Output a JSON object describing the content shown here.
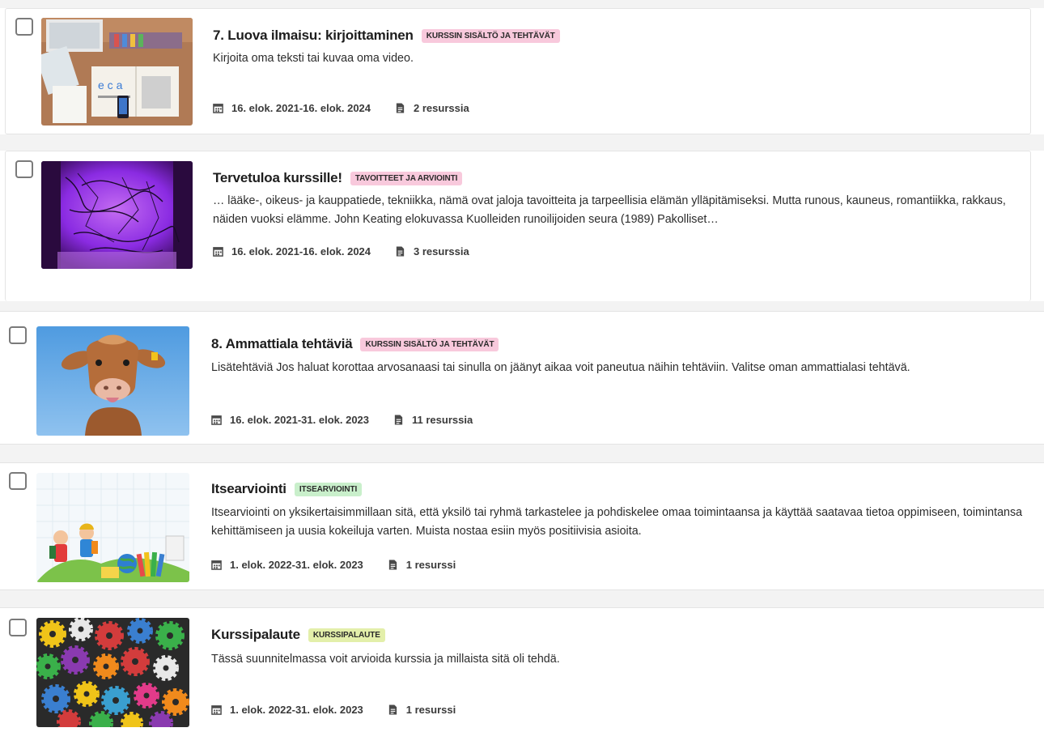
{
  "colors": {
    "badge_pink": "#f8c9dc",
    "badge_green": "#c9efcb",
    "badge_lime": "#e3efaa",
    "separator_gray": "#f3f3f3",
    "icon_gray": "#4a4a4a"
  },
  "cards": [
    {
      "title": "7. Luova ilmaisu: kirjoittaminen",
      "badge": "KURSSIN SISÄLTÖ JA TEHTÄVÄT",
      "description": "Kirjoita oma teksti tai kuvaa oma video.",
      "dates": "16. elok. 2021-16. elok. 2024",
      "resources": "2 resurssia"
    },
    {
      "title": "Tervetuloa kurssille!",
      "badge": "TAVOITTEET JA ARVIOINTI",
      "description": "… lääke-, oikeus- ja kauppatiede, tekniikka, nämä ovat jaloja tavoitteita ja tarpeellisia elämän ylläpitämiseksi. Mutta runous, kauneus, romantiikka, rakkaus, näiden vuoksi elämme.   John Keating elokuvassa Kuolleiden runoilijoiden seura (1989)   Pakolliset…",
      "dates": "16. elok. 2021-16. elok. 2024",
      "resources": "3 resurssia"
    },
    {
      "title": "8. Ammattiala tehtäviä",
      "badge": "KURSSIN SISÄLTÖ JA TEHTÄVÄT",
      "description": "Lisätehtäviä Jos haluat korottaa arvosanaasi tai sinulla on jäänyt aikaa voit paneutua näihin tehtäviin. Valitse oman ammattialasi tehtävä.",
      "dates": "16. elok. 2021-31. elok. 2023",
      "resources": "11 resurssia"
    },
    {
      "title": "Itsearviointi",
      "badge": "ITSEARVIOINTI",
      "description": "Itsearviointi on yksikertaisimmillaan sitä, että yksilö tai ryhmä tarkastelee ja pohdiskelee omaa toimintaansa ja käyttää saatavaa tietoa oppimiseen, toimintansa kehittämiseen ja uusia kokeiluja varten. Muista nostaa esiin myös positiivisia asioita.",
      "dates": "1. elok. 2022-31. elok. 2023",
      "resources": "1 resurssi"
    },
    {
      "title": "Kurssipalaute",
      "badge": "KURSSIPALAUTE",
      "description": "Tässä suunnitelmassa voit arvioida kurssia ja millaista sitä oli tehdä.",
      "dates": "1. elok. 2022-31. elok. 2023",
      "resources": "1 resurssi"
    }
  ]
}
